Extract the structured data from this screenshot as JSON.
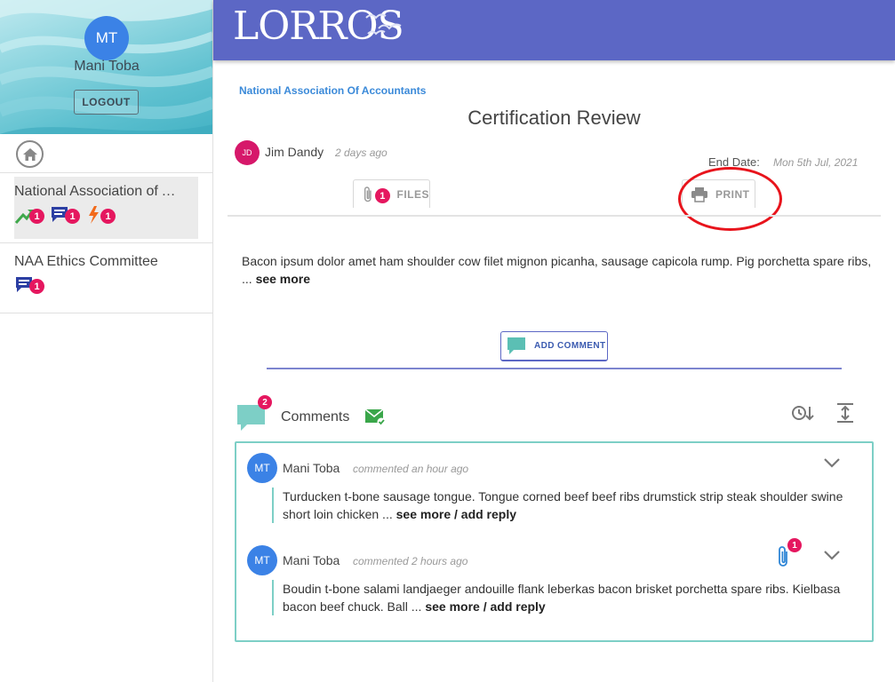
{
  "user": {
    "initials": "MT",
    "name": "Mani Toba",
    "logout_label": "LOGOUT"
  },
  "sidebar": {
    "items": [
      {
        "title": "National Association of Accountants",
        "badges": [
          "1",
          "1",
          "1"
        ]
      },
      {
        "title": "NAA Ethics Committee",
        "badges": [
          "1"
        ]
      }
    ]
  },
  "header": {
    "logo": "LORROS"
  },
  "main": {
    "org": "National Association Of Accountants",
    "title": "Certification Review",
    "author": {
      "initials": "JD",
      "name": "Jim Dandy",
      "time": "2 days ago"
    },
    "end_label": "End Date:",
    "end_date": "Mon 5th Jul, 2021",
    "tabs": {
      "files_label": "FILES",
      "files_badge": "1",
      "print_label": "PRINT"
    },
    "body": "Bacon ipsum dolor amet ham shoulder cow filet mignon picanha, sausage capicola rump. Pig porchetta spare ribs, ...",
    "see_more": "see more",
    "add_comment_label": "ADD COMMENT"
  },
  "comments": {
    "label": "Comments",
    "count_badge": "2",
    "items": [
      {
        "initials": "MT",
        "name": "Mani Toba",
        "time": "commented an hour ago",
        "body": "Turducken t-bone sausage tongue. Tongue corned beef beef ribs drumstick strip steak shoulder swine short loin chicken ...",
        "more": "see more / add reply"
      },
      {
        "initials": "MT",
        "name": "Mani Toba",
        "time": "commented 2 hours ago",
        "body": "Boudin t-bone salami landjaeger andouille flank leberkas bacon brisket porchetta spare ribs. Kielbasa bacon beef chuck. Ball ...",
        "more": "see more / add reply",
        "attachment_badge": "1"
      }
    ]
  },
  "colors": {
    "header": "#5c67c5",
    "badge": "#e5175f",
    "accent": "#7dcfc6",
    "highlight": "#e8141c"
  }
}
